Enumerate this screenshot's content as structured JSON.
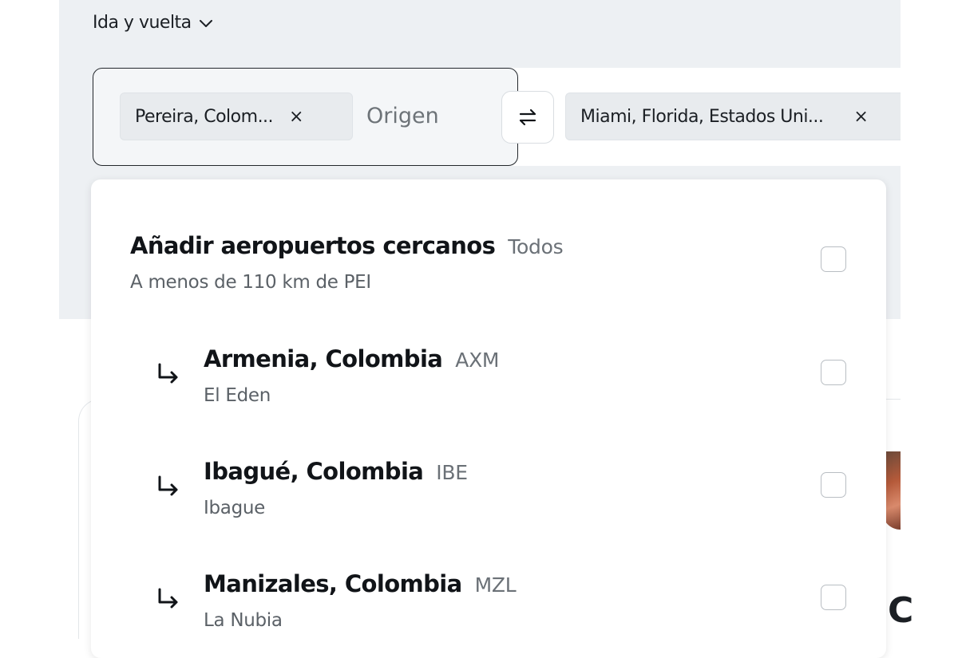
{
  "trip_type": {
    "label": "Ida y vuelta"
  },
  "search": {
    "origin_chip": "Pereira, Colom...",
    "origin_placeholder": "Origen",
    "destination_chip": "Miami, Florida, Estados Uni...",
    "chip_remove": "×"
  },
  "nearby": {
    "title": "Añadir aeropuertos cercanos",
    "all_label": "Todos",
    "subtitle": "A menos de 110 km de PEI"
  },
  "airports": [
    {
      "city": "Armenia, Colombia",
      "code": "AXM",
      "airport": "El Eden"
    },
    {
      "city": "Ibagué, Colombia",
      "code": "IBE",
      "airport": "Ibague"
    },
    {
      "city": "Manizales, Colombia",
      "code": "MZL",
      "airport": "La Nubia"
    }
  ],
  "background": {
    "partial_letter": "C"
  },
  "icons": {
    "trip_dropdown": "chevron-down-icon",
    "swap": "swap-arrows-icon",
    "remove": "close-icon",
    "nearby": "return-arrow-icon"
  },
  "colors": {
    "header_bg": "#edf0f3",
    "text": "#111418",
    "muted": "#6b7177"
  }
}
